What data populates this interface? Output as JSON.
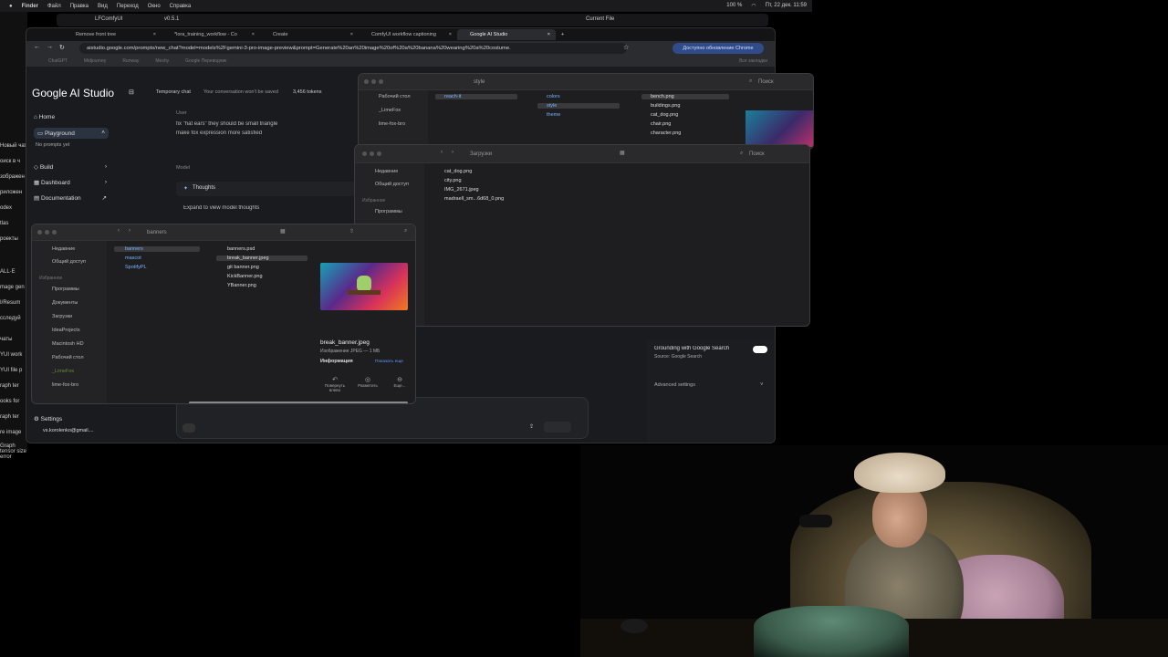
{
  "menubar": {
    "items": [
      "Finder",
      "Файл",
      "Правка",
      "Вид",
      "Переход",
      "Окно",
      "Справка"
    ],
    "battery": "100 %",
    "datetime": "Пт, 22 дек. 11:59"
  },
  "left_strip": [
    "Новый чат",
    "оиск в ч",
    "зображен",
    "риложен",
    "odex",
    "tlas",
    "роекты",
    "ALL·E",
    "mage gen",
    "I/Resum",
    "сследуй",
    "чаты",
    "YUI work",
    "YUI file p",
    "raph ter",
    "ooks for",
    "raph ter",
    "re image",
    "Graph tensor size error"
  ],
  "comfy_bar": {
    "tab": "LFComfyUI",
    "version": "v0.5.1",
    "current_file": "Current File"
  },
  "browser": {
    "tabs": [
      {
        "title": "Remove front tree"
      },
      {
        "title": "*lora_training_workflow - Co"
      },
      {
        "title": "Create"
      },
      {
        "title": "ComfyUI workflow captioning"
      },
      {
        "title": "Google AI Studio"
      }
    ],
    "url": "aistudio.google.com/prompts/new_chat?model=models%2Fgemini-3-pro-image-preview&prompt=Generate%20an%20image%20of%20a%20banana%20wearing%20a%20costume.",
    "update_button": "Доступно обновление Chrome",
    "bookmarks": [
      "ChatGPT",
      "Midjourney",
      "Runway",
      "Meshy",
      "Google Переводчик"
    ],
    "bookmarks_right": "Все закладки"
  },
  "studio": {
    "logo": "Google AI Studio",
    "temp_chat": "Temporary chat",
    "temp_note": "Your conversation won't be saved",
    "tokens": "3,456 tokens",
    "nav": [
      "Home",
      "Playground",
      "No prompts yet",
      "Build",
      "Dashboard",
      "Documentation"
    ],
    "user_label": "User",
    "user_msg_1": "fix \"hat ears\" they should be small triangle",
    "user_msg_2": "make fox expression more satisfied",
    "model_label": "Model",
    "thoughts": "Thoughts",
    "expand": "Expand to view model thoughts",
    "settings": "Settings",
    "account": "vs.korolenko@gmail....",
    "grounding": "Grounding with Google Search",
    "source": "Source: Google Search",
    "advanced": "Advanced settings",
    "input_placeholder": "Спросите что-нибудь"
  },
  "finder_style": {
    "path": "style",
    "search": "Поиск",
    "sidebar": [
      "Рабочий стол",
      "_LimeFox",
      "lime-fox-bro"
    ],
    "col1": [
      "reach-it"
    ],
    "col2": [
      "colors",
      "style",
      "theme"
    ],
    "col3": [
      "bench.png",
      "buildings.png",
      "cat_dog.png",
      "chair.png",
      "character.png"
    ]
  },
  "finder_downloads": {
    "path": "Загрузки",
    "search": "Поиск",
    "sidebar": [
      "Недавние",
      "Общий доступ",
      "Избранное",
      "Программы"
    ],
    "files": [
      "cat_dog.png",
      "city.png",
      "IMG_2671.jpeg",
      "madraell_sm...6d68_0.png"
    ]
  },
  "finder_banners": {
    "path": "banners",
    "sidebar": [
      "Недавние",
      "Общий доступ",
      "Избранное",
      "Программы",
      "Документы",
      "Загрузки",
      "IdeaProjects",
      "Macintosh HD",
      "Рабочий стол",
      "_LimeFox",
      "lime-fox-bro"
    ],
    "col1": [
      "banners",
      "mascot",
      "SpotifyPL"
    ],
    "col2": [
      "banners.psd",
      "break_banner.jpeg",
      "git banner.png",
      "KickBanner.png",
      "YBanner.png"
    ],
    "preview_name": "break_banner.jpeg",
    "preview_meta": "Изображение JPEG — 1 МБ",
    "info": "Информация",
    "show_more": "Показать еще",
    "actions": [
      "Повернуть влево",
      "Разметить",
      "Еще..."
    ]
  },
  "colors": {
    "accent": "#2f4b8a",
    "folder": "#77b4ff",
    "toggle": "#ffffff"
  }
}
